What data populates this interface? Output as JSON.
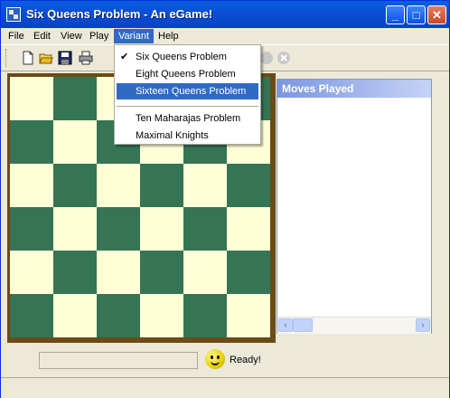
{
  "window": {
    "title": "Six Queens Problem - An eGame!"
  },
  "title_buttons": {
    "minimize": "_",
    "maximize": "□",
    "close": "✕"
  },
  "menubar": [
    "File",
    "Edit",
    "View",
    "Play",
    "Variant",
    "Help"
  ],
  "variant_menu": {
    "items": [
      "Six Queens Problem",
      "Eight Queens Problem",
      "Sixteen Queens Problem",
      "Ten Maharajas Problem",
      "Maximal Knights"
    ],
    "checked": "Six Queens Problem",
    "highlighted": "Sixteen Queens Problem",
    "check_glyph": "✔"
  },
  "toolbar": {
    "icons": [
      "new-document-icon",
      "open-folder-icon",
      "save-disk-icon",
      "print-icon"
    ]
  },
  "board": {
    "size": 6,
    "light_color": "#ffffd7",
    "dark_color": "#357455",
    "frame_color": "#6b4b16"
  },
  "moves_panel": {
    "header": "Moves Played",
    "scroll_left": "‹",
    "scroll_right": "›"
  },
  "status": {
    "text": "Ready!"
  }
}
